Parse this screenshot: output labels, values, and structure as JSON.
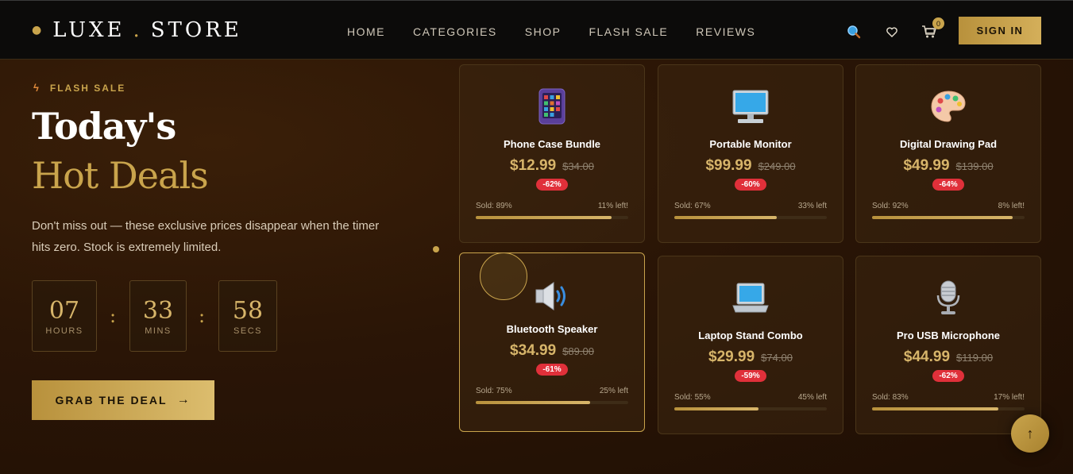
{
  "nav": {
    "logo_left": "LUXE",
    "logo_dot": ".",
    "logo_right": "STORE",
    "links": [
      "HOME",
      "CATEGORIES",
      "SHOP",
      "FLASH SALE",
      "REVIEWS"
    ],
    "cart_count": "0",
    "signin_label": "SIGN IN",
    "icons": [
      "search-icon",
      "heart-icon",
      "cart-icon"
    ]
  },
  "hero": {
    "tag": "FLASH SALE",
    "title_line1": "Today's",
    "title_line2": "Hot Deals",
    "description": "Don't miss out — these exclusive prices disappear when the timer hits zero. Stock is extremely limited.",
    "timer": {
      "hours": "07",
      "hours_label": "HOURS",
      "mins": "33",
      "mins_label": "MINS",
      "secs": "58",
      "secs_label": "SECS",
      "separator": ":"
    },
    "cta_label": "GRAB THE DEAL",
    "cta_arrow": "→"
  },
  "products": [
    {
      "name": "Phone Case Bundle",
      "price": "$12.99",
      "old_price": "$34.00",
      "discount": "-62%",
      "sold": "Sold: 89%",
      "left": "11% left!",
      "sold_fraction": 0.89,
      "icon": "tablet-icon",
      "emoji": "📱"
    },
    {
      "name": "Portable Monitor",
      "price": "$99.99",
      "old_price": "$249.00",
      "discount": "-60%",
      "sold": "Sold: 67%",
      "left": "33% left",
      "sold_fraction": 0.67,
      "icon": "monitor-icon",
      "emoji": "🖥️"
    },
    {
      "name": "Digital Drawing Pad",
      "price": "$49.99",
      "old_price": "$139.00",
      "discount": "-64%",
      "sold": "Sold: 92%",
      "left": "8% left!",
      "sold_fraction": 0.92,
      "icon": "palette-icon",
      "emoji": "🎨"
    },
    {
      "name": "Bluetooth Speaker",
      "price": "$34.99",
      "old_price": "$89.00",
      "discount": "-61%",
      "sold": "Sold: 75%",
      "left": "25% left",
      "sold_fraction": 0.75,
      "icon": "speaker-icon",
      "emoji": "🔊"
    },
    {
      "name": "Laptop Stand Combo",
      "price": "$29.99",
      "old_price": "$74.00",
      "discount": "-59%",
      "sold": "Sold: 55%",
      "left": "45% left",
      "sold_fraction": 0.55,
      "icon": "laptop-icon",
      "emoji": "💻"
    },
    {
      "name": "Pro USB Microphone",
      "price": "$44.99",
      "old_price": "$119.00",
      "discount": "-62%",
      "sold": "Sold: 83%",
      "left": "17% left!",
      "sold_fraction": 0.83,
      "icon": "microphone-icon",
      "emoji": "🎙️"
    }
  ],
  "scroll_top_label": "↑",
  "colors": {
    "accent": "#c9a44c",
    "discount": "#e0303a",
    "nav_bg": "#0c0b0a"
  }
}
